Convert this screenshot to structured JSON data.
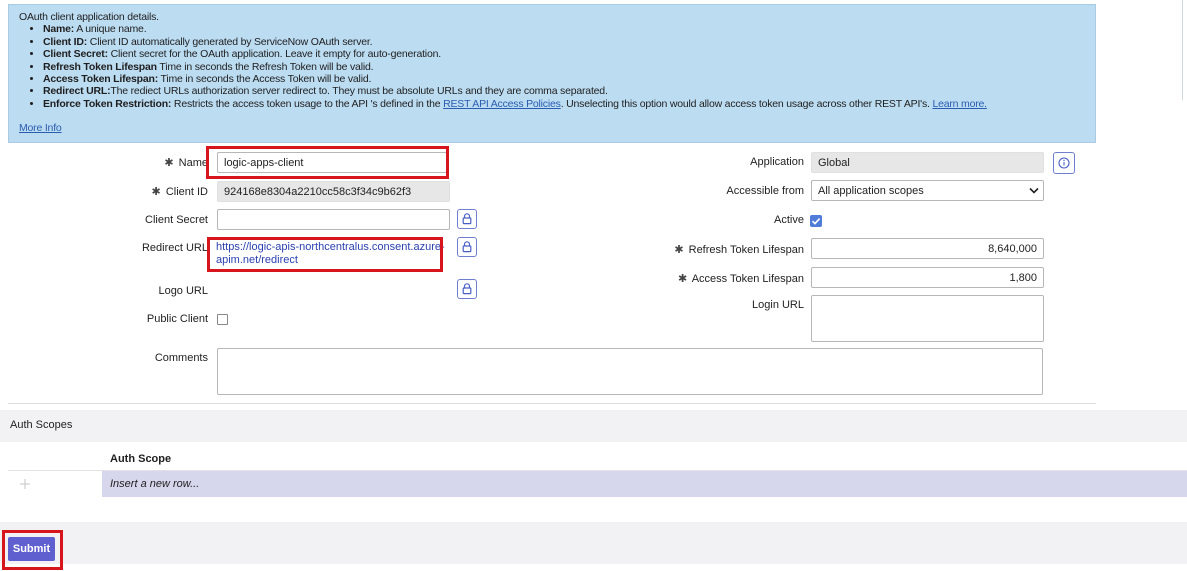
{
  "info_box": {
    "title": "OAuth client application details.",
    "items": [
      {
        "term": "Name:",
        "desc": " A unique name."
      },
      {
        "term": "Client ID:",
        "desc": " Client ID automatically generated by ServiceNow OAuth server."
      },
      {
        "term": "Client Secret:",
        "desc": " Client secret for the OAuth application. Leave it empty for auto-generation."
      },
      {
        "term": "Refresh Token Lifespan",
        "desc": " Time in seconds the Refresh Token will be valid."
      },
      {
        "term": "Access Token Lifespan:",
        "desc": " Time in seconds the Access Token will be valid."
      },
      {
        "term": "Redirect URL:",
        "desc": "The rediect URLs authorization server redirect to. They must be absolute URLs and they are comma separated."
      }
    ],
    "enforce": {
      "term": "Enforce Token Restriction:",
      "desc_before": " Restricts the access token usage to the API 's defined in the ",
      "link1": "REST API Access Policies",
      "desc_after": ". Unselecting this option would allow access token usage across other REST API's. ",
      "link2": "Learn more."
    },
    "more_info": "More Info"
  },
  "form": {
    "required_marker": "✱",
    "name": {
      "label": "Name",
      "value": "logic-apps-client"
    },
    "client_id": {
      "label": "Client ID",
      "value": "924168e8304a2210cc58c3f34c9b62f3"
    },
    "client_secret": {
      "label": "Client Secret",
      "value": ""
    },
    "redirect_url": {
      "label": "Redirect URL",
      "value_line1": "https://logic-apis-northcentralus.consent.azure-",
      "value_line2": "apim.net/redirect"
    },
    "logo_url": {
      "label": "Logo URL"
    },
    "public_client": {
      "label": "Public Client"
    },
    "comments": {
      "label": "Comments",
      "value": ""
    },
    "application": {
      "label": "Application",
      "value": "Global"
    },
    "accessible_from": {
      "label": "Accessible from",
      "value": "All application scopes"
    },
    "active": {
      "label": "Active"
    },
    "refresh_token": {
      "label": "Refresh Token Lifespan",
      "value": "8,640,000"
    },
    "access_token": {
      "label": "Access Token Lifespan",
      "value": "1,800"
    },
    "login_url": {
      "label": "Login URL",
      "value": ""
    }
  },
  "auth_scopes": {
    "section_title": "Auth Scopes",
    "column_header": "Auth Scope",
    "add_icon": "plus-icon",
    "insert_row": "Insert a new row..."
  },
  "submit_label": "Submit",
  "colors": {
    "accent": "#5f5fcf",
    "highlight": "#d6151c",
    "info_bg": "#bcdcf2"
  }
}
